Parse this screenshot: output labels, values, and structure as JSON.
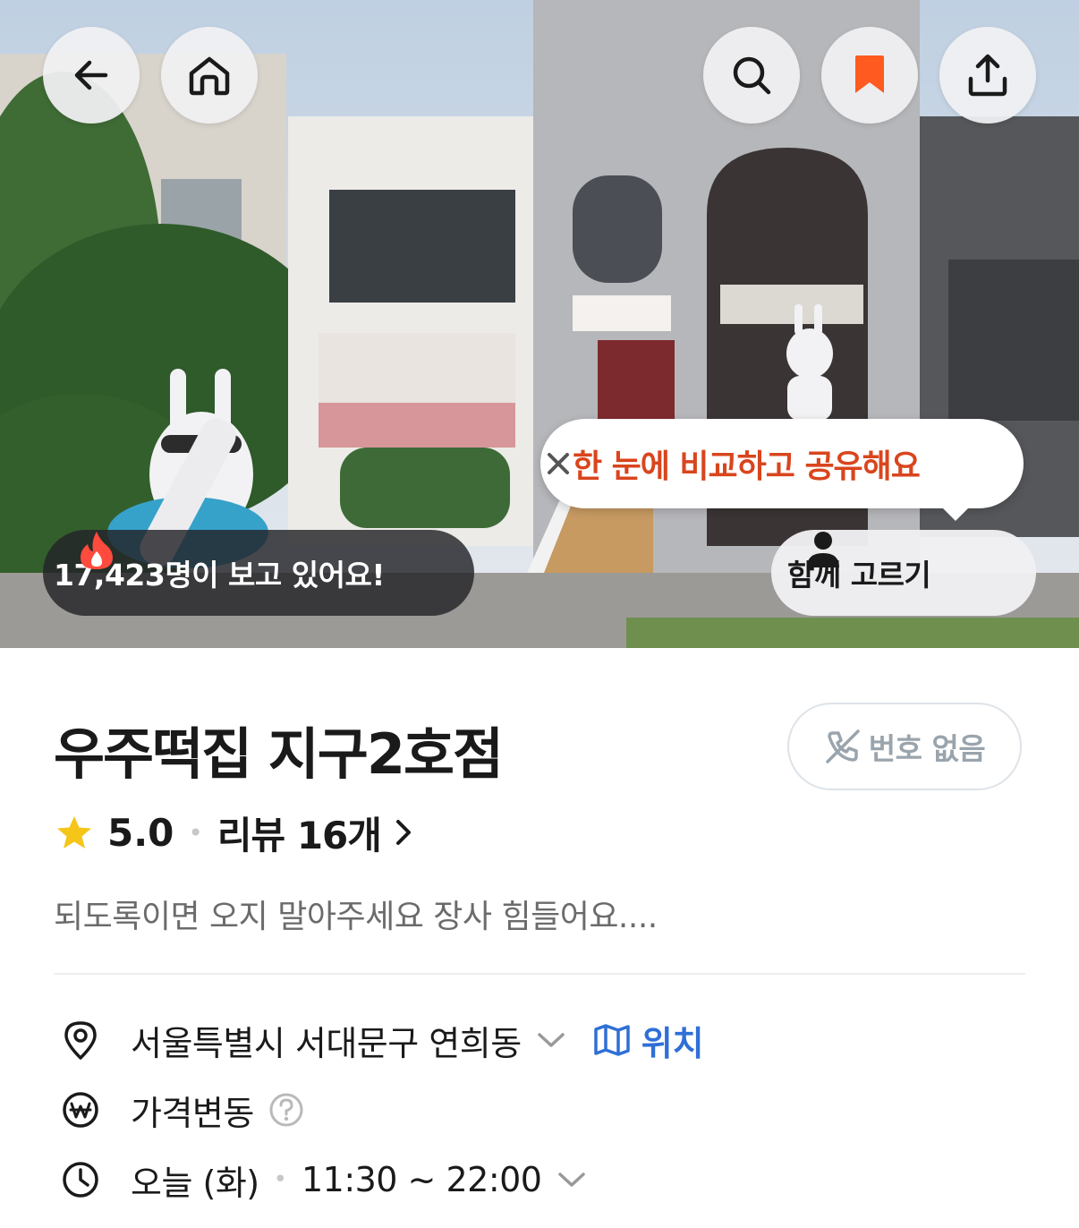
{
  "top_bar": {
    "back_icon": "arrow-left-icon",
    "home_icon": "home-icon",
    "search_icon": "search-icon",
    "bookmark_icon": "bookmark-icon",
    "share_icon": "share-icon",
    "bookmark_color": "#ff5a1f"
  },
  "hero": {
    "viewers_text": "17,423명이 보고 있어요!",
    "tooltip_text": "한 눈에 비교하고 공유해요",
    "together_label": "함께 고르기"
  },
  "place": {
    "name": "우주떡집 지구2호점",
    "phone_label": "번호 없음",
    "rating": "5.0",
    "reviews_label": "리뷰 16개",
    "description": "되도록이면 오지 말아주세요 장사 힘들어요...."
  },
  "details": {
    "address": "서울특별시 서대문구 연희동",
    "location_link": "위치",
    "price_label": "가격변동",
    "hours_day": "오늘 (화)",
    "hours_time": "11:30 ~ 22:00"
  },
  "colors": {
    "accent_orange": "#d9451d",
    "link_blue": "#2f6fd6",
    "star_yellow": "#f5c518"
  }
}
